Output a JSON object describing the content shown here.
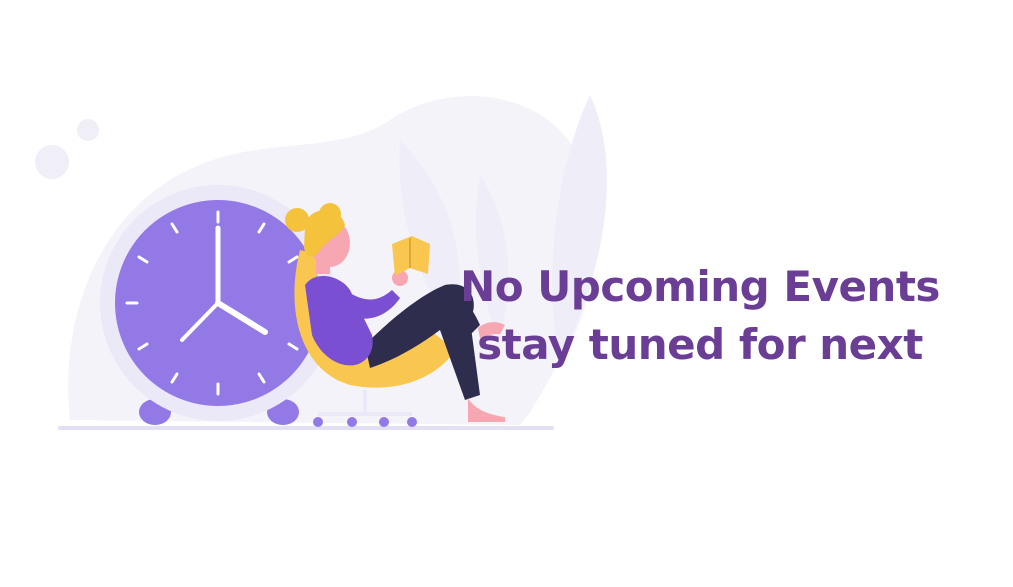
{
  "empty_state": {
    "title": "No Upcoming Events",
    "subtitle": "stay tuned for next"
  },
  "colors": {
    "text": "#6b3e96",
    "clock_face": "#9379e6",
    "clock_rim": "#ebe8f7",
    "chair": "#f9c74f",
    "hair": "#f5c33b",
    "shirt": "#7a4fd1",
    "pants": "#2f2d4e",
    "skin": "#f7a7b2",
    "background_blob": "#f4f3fa"
  },
  "illustration": {
    "icon": "alarm-clock-person-reading-illustration"
  }
}
